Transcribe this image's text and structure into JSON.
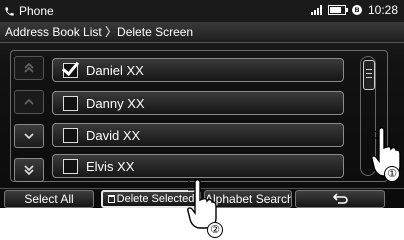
{
  "status": {
    "app_icon": "phone-icon",
    "app_title": "Phone",
    "time": "10:28",
    "icons": [
      "signal-icon",
      "battery-icon",
      "bluetooth-icon"
    ]
  },
  "breadcrumb": {
    "text": "Address Book List 〉Delete Screen"
  },
  "nav": {
    "icons": [
      "page-up-icon",
      "up-icon",
      "down-icon",
      "page-down-icon"
    ]
  },
  "contacts": [
    {
      "name": "Daniel XX",
      "checked": true
    },
    {
      "name": "Danny XX",
      "checked": false
    },
    {
      "name": "David XX",
      "checked": false
    },
    {
      "name": "Elvis XX",
      "checked": false
    }
  ],
  "bottom": {
    "select_all": "Select All",
    "delete_selected": "Delete Selected",
    "alphabet_search": "Alphabet Search",
    "back_icon": "return-icon"
  },
  "callouts": [
    "①",
    "②"
  ],
  "colors": {
    "screen_bg": "#0b0b0b",
    "text": "#ffffff",
    "outline": "#8a8a8a"
  }
}
